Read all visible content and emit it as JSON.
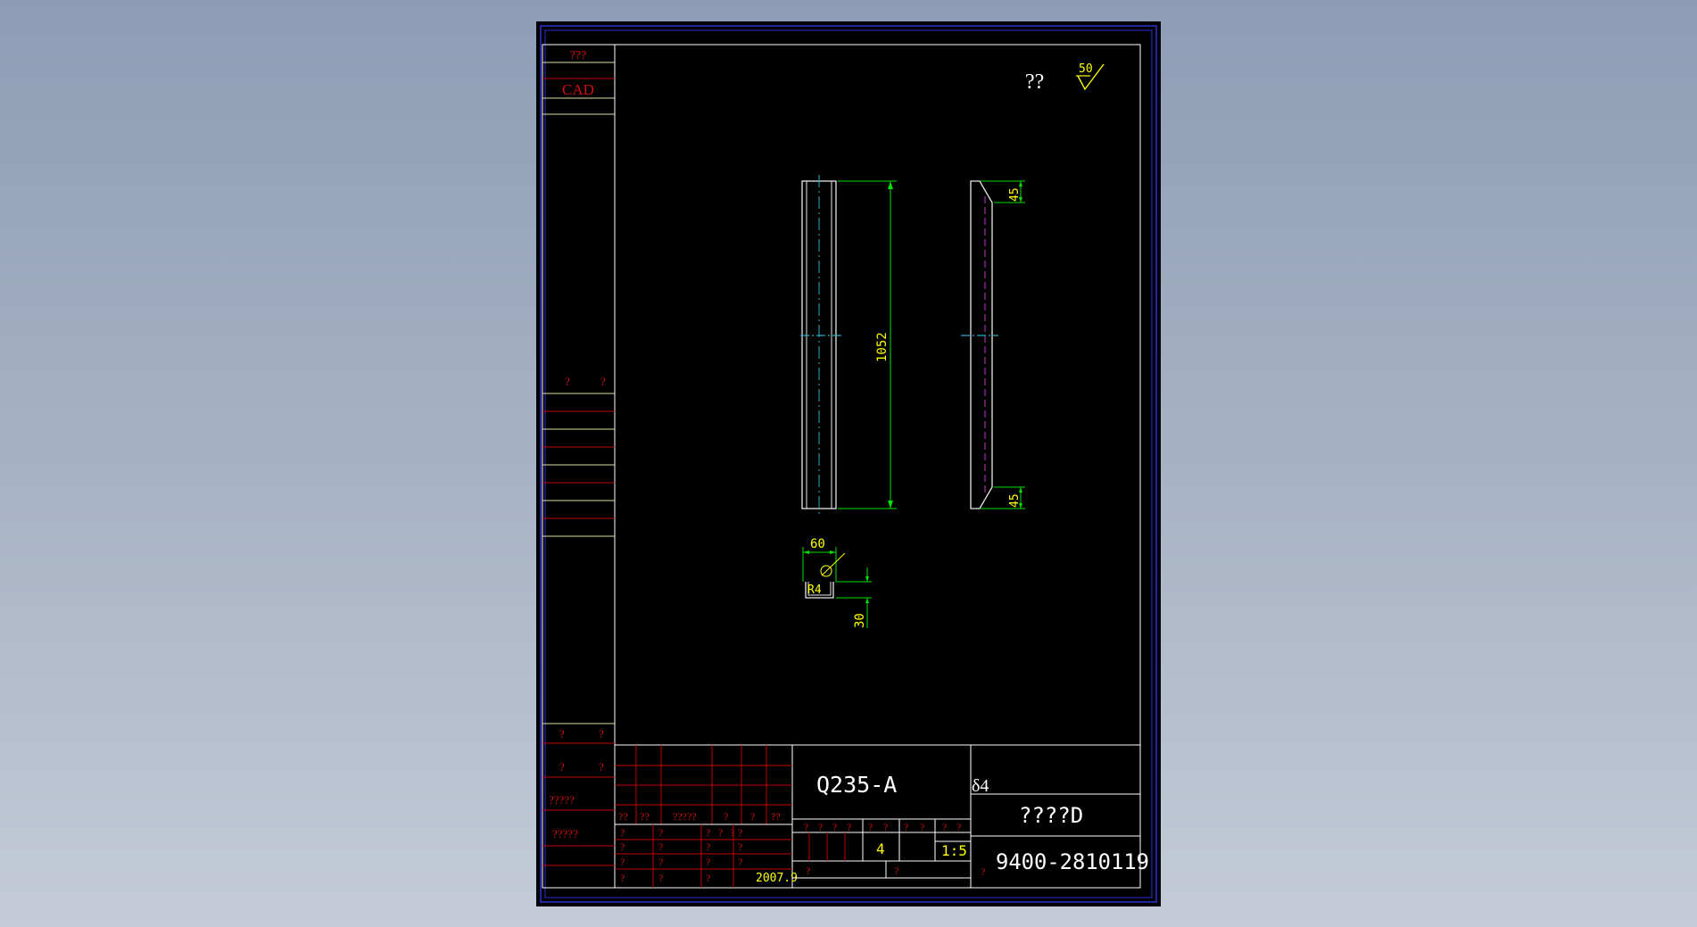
{
  "left_column": {
    "title_mark": "???",
    "cad_label": "CAD",
    "row_a": [
      "?",
      "?"
    ],
    "row_b": [
      "?",
      "?"
    ],
    "row_c": [
      "?",
      "?"
    ],
    "label_d": "?????",
    "label_e": "?????"
  },
  "roughness": {
    "label": "??",
    "value": "50"
  },
  "dimensions": {
    "length": "1052",
    "bevel_top": "45",
    "bevel_bottom": "45",
    "width": "60",
    "height": "30",
    "radius": "R4"
  },
  "title_block": {
    "material": "Q235-A",
    "thickness": "δ4",
    "part_name": "????D",
    "drawing_number": "9400-2810119",
    "quantity": "4",
    "scale": "1:5",
    "date": "2007.9",
    "header_row": [
      "??",
      "??",
      "?????",
      "?",
      "?",
      "??"
    ],
    "left_grid_rows": [
      [
        "?",
        "?",
        "?",
        "?",
        "?",
        "?"
      ],
      [
        "?",
        "?",
        "?",
        "?"
      ],
      [
        "?",
        "?",
        "?",
        "?"
      ],
      [
        "?",
        "?",
        "?"
      ]
    ],
    "mid_labels": [
      "?",
      "?",
      "?",
      "?",
      "?",
      "?",
      "?",
      "?",
      "?",
      "?"
    ],
    "bottom_marks": [
      "?",
      "?",
      "?"
    ]
  }
}
